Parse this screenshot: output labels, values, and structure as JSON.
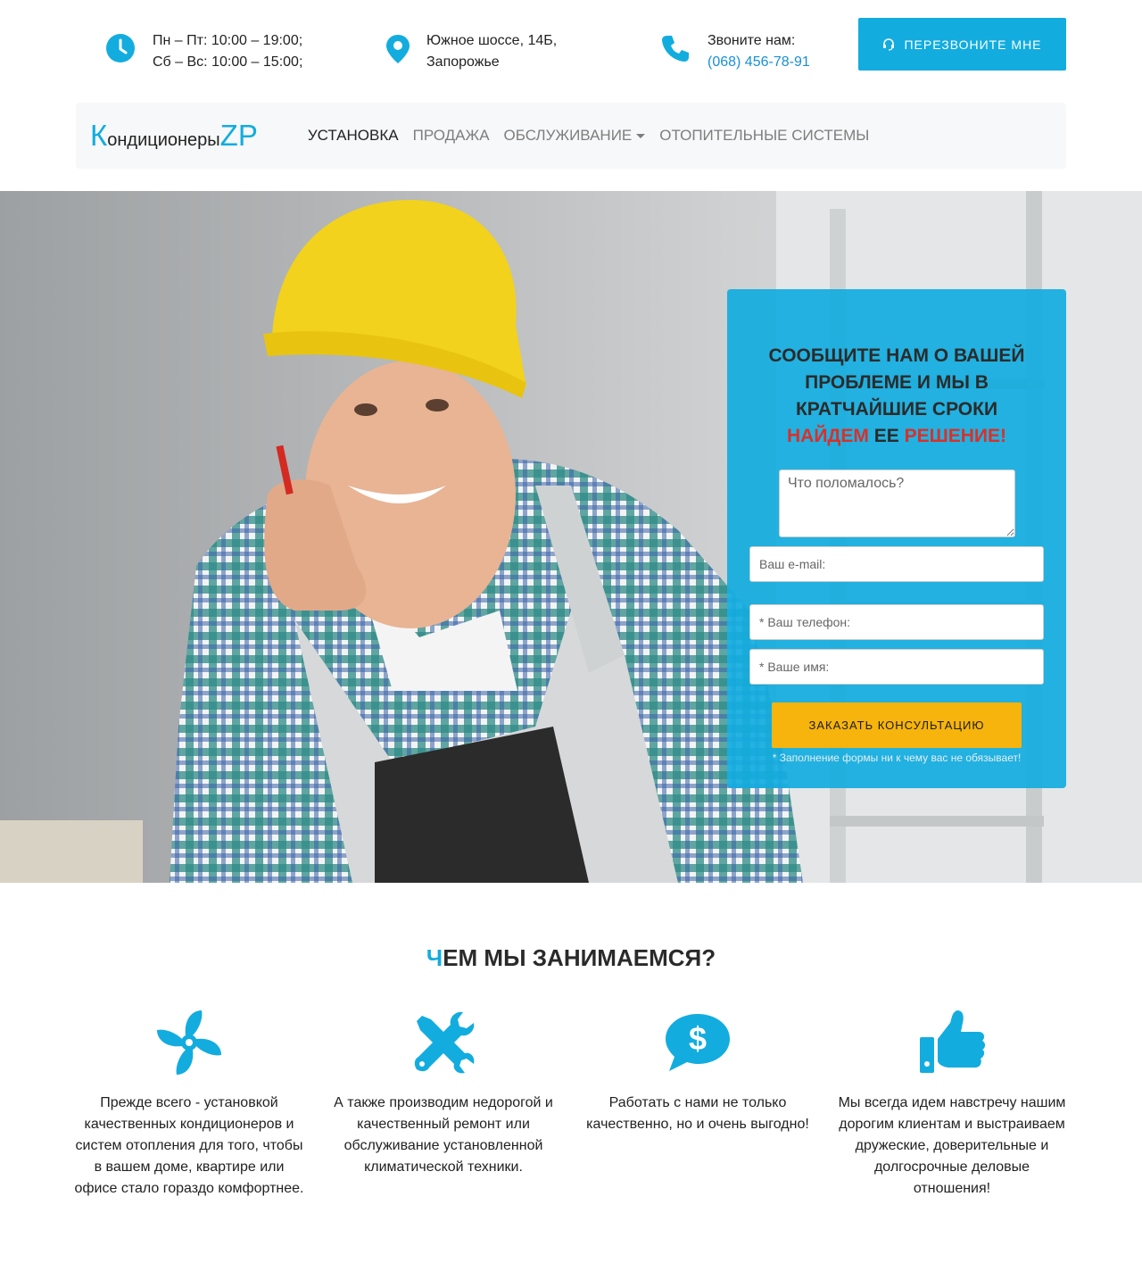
{
  "topbar": {
    "hours_line1": "Пн – Пт: 10:00 – 19:00;",
    "hours_line2": "Сб – Вс: 10:00 – 15:00;",
    "address_line1": "Южное шоссе, 14Б,",
    "address_line2": "Запорожье",
    "call_label": "Звоните нам:",
    "phone": "(068) 456-78-91",
    "callback_button": "ПЕРЕЗВОНИТЕ МНЕ"
  },
  "navbar": {
    "brand_initial": "К",
    "brand_middle": "ондиционеры",
    "brand_suffix": "ZP",
    "items": [
      {
        "label": "УСТАНОВКА"
      },
      {
        "label": "ПРОДАЖА"
      },
      {
        "label": "ОБСЛУЖИВАНИЕ"
      },
      {
        "label": "ОТОПИТЕЛЬНЫЕ СИСТЕМЫ"
      }
    ]
  },
  "form": {
    "title_line1": "СООБЩИТЕ НАМ О ВАШЕЙ ПРОБЛЕМЕ И МЫ В КРАТЧАЙШИЕ СРОКИ",
    "title_red1": "НАЙДЕМ",
    "title_mid": "ЕЕ",
    "title_red2": "РЕШЕНИЕ!",
    "problem_placeholder": "Что поломалось?",
    "email_placeholder": "Ваш e-mail:",
    "phone_placeholder": "* Ваш телефон:",
    "name_placeholder": "* Ваше имя:",
    "submit_label": "ЗАКАЗАТЬ КОНСУЛЬТАЦИЮ",
    "note": "* Заполнение формы ни к чему вас не обязывает!"
  },
  "services": {
    "title_first": "Ч",
    "title_rest": "ЕМ МЫ ЗАНИМАЕМСЯ?",
    "items": [
      {
        "icon": "fan-icon",
        "text": "Прежде всего - установкой качественных кондиционеров и систем отопления для того, чтобы в вашем доме, квартире или офисе стало гораздо комфортнее."
      },
      {
        "icon": "tools-icon",
        "text": "А также производим недорогой и качественный ремонт или обслуживание установленной климатической техники."
      },
      {
        "icon": "dollar-chat-icon",
        "text": "Работать с нами не только качественно, но и очень выгодно!"
      },
      {
        "icon": "thumbs-up-icon",
        "text": "Мы всегда идем навстречу нашим дорогим клиентам и выстраиваем дружеские, доверительные и долгосрочные деловые отношения!"
      }
    ]
  },
  "colors": {
    "accent": "#13acdf",
    "button_yellow": "#f6b40c",
    "highlight_red": "#d9302a",
    "link_blue": "#1a8fd6"
  }
}
